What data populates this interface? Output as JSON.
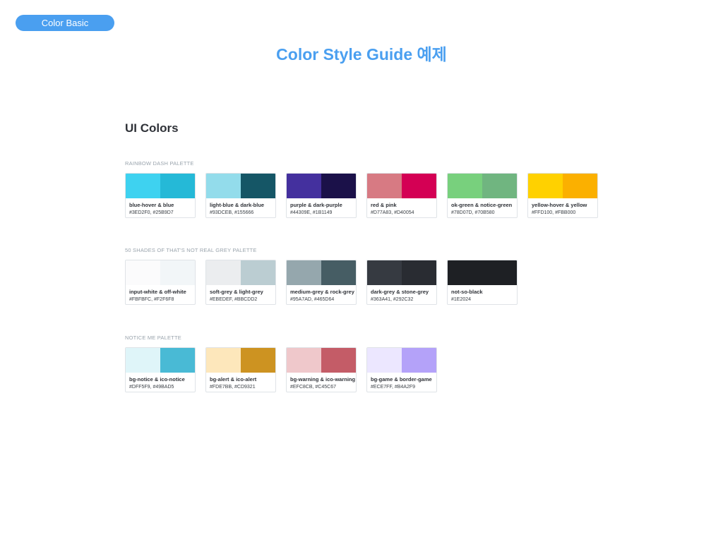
{
  "header": {
    "tag": "Color Basic",
    "title": "Color Style Guide 예제"
  },
  "section": {
    "title": "UI Colors"
  },
  "palettes": [
    {
      "label": "RAINBOW DASH PALETTE",
      "swatches": [
        {
          "name": "blue-hover & blue",
          "hex": "#3ED2F0, #25B9D7",
          "colors": [
            "#3ED2F0",
            "#25B9D7"
          ]
        },
        {
          "name": "light-blue & dark-blue",
          "hex": "#93DCEB, #155666",
          "colors": [
            "#93DCEB",
            "#155666"
          ]
        },
        {
          "name": "purple & dark-purple",
          "hex": "#44309E, #1B1149",
          "colors": [
            "#44309E",
            "#1B1149"
          ]
        },
        {
          "name": "red & pink",
          "hex": "#D77A83, #D40054",
          "colors": [
            "#D77A83",
            "#D40054"
          ]
        },
        {
          "name": "ok-green & notice-green",
          "hex": "#78D07D, #70B580",
          "colors": [
            "#78D07D",
            "#70B580"
          ]
        },
        {
          "name": "yellow-hover & yellow",
          "hex": "#FFD100, #FBB000",
          "colors": [
            "#FFD100",
            "#FBB000"
          ]
        }
      ]
    },
    {
      "label": "50 SHADES OF THAT'S NOT REAL GREY PALETTE",
      "swatches": [
        {
          "name": "input-white & off-white",
          "hex": "#FBFBFC, #F2F6F8",
          "colors": [
            "#FBFBFC",
            "#F2F6F8"
          ]
        },
        {
          "name": "soft-grey & light-grey",
          "hex": "#EBEDEF, #BBCDD2",
          "colors": [
            "#EBEDEF",
            "#BBCDD2"
          ]
        },
        {
          "name": "medium-grey & rock-grey",
          "hex": "#95A7AD, #465D64",
          "colors": [
            "#95A7AD",
            "#465D64"
          ]
        },
        {
          "name": "dark-grey & stone-grey",
          "hex": "#363A41, #292C32",
          "colors": [
            "#363A41",
            "#292C32"
          ]
        },
        {
          "name": "not-so-black",
          "hex": "#1E2024",
          "colors": [
            "#1E2024"
          ]
        }
      ]
    },
    {
      "label": "NOTICE ME PALETTE",
      "swatches": [
        {
          "name": "bg-notice & ico-notice",
          "hex": "#DFF5F9, #49BAD5",
          "colors": [
            "#DFF5F9",
            "#49BAD5"
          ]
        },
        {
          "name": "bg-alert & ico-alert",
          "hex": "#FDE7BB, #CD9321",
          "colors": [
            "#FDE7BB",
            "#CD9321"
          ]
        },
        {
          "name": "bg-warning & ico-warning",
          "hex": "#EFC8CB, #C45C67",
          "colors": [
            "#EFC8CB",
            "#C45C67"
          ]
        },
        {
          "name": "bg-game & border-game",
          "hex": "#ECE7FF, #B4A2F9",
          "colors": [
            "#ECE7FF",
            "#B4A2F9"
          ]
        }
      ]
    }
  ]
}
